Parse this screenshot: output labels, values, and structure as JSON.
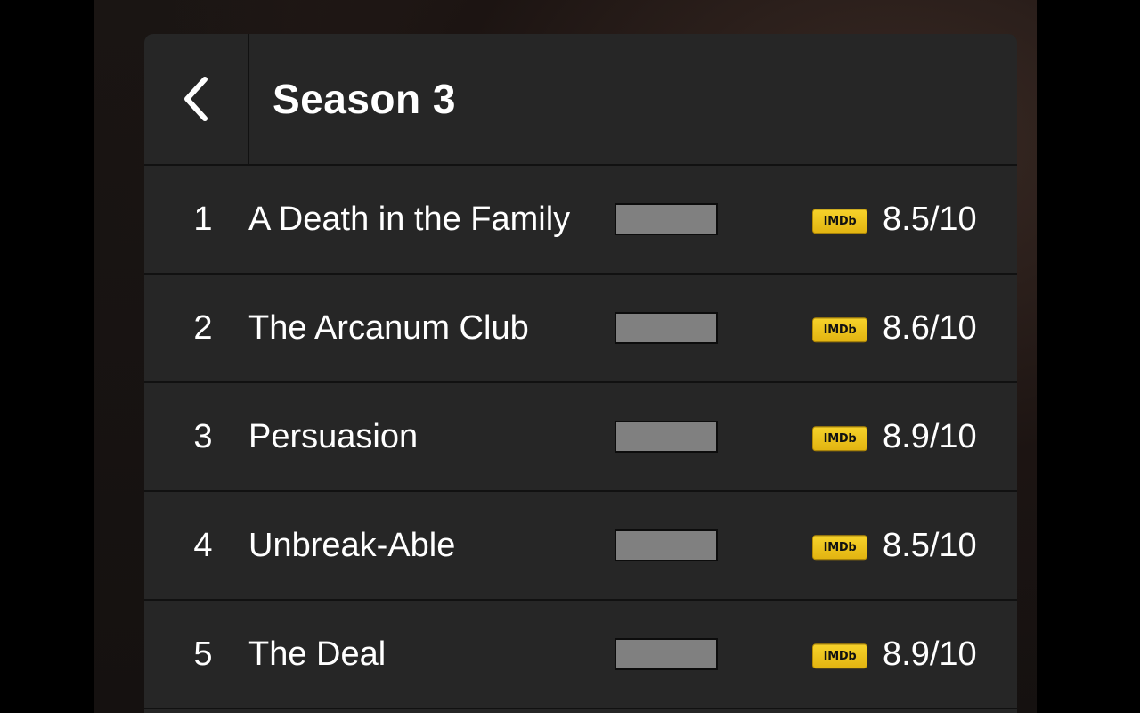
{
  "header": {
    "back_icon": "chevron-left-icon",
    "title": "Season 3"
  },
  "episodes": [
    {
      "number": "1",
      "title": "A Death in the Family",
      "badge": "IMDb",
      "rating": "8.5/10"
    },
    {
      "number": "2",
      "title": "The Arcanum Club",
      "badge": "IMDb",
      "rating": "8.6/10"
    },
    {
      "number": "3",
      "title": "Persuasion",
      "badge": "IMDb",
      "rating": "8.9/10"
    },
    {
      "number": "4",
      "title": "Unbreak-Able",
      "badge": "IMDb",
      "rating": "8.5/10"
    },
    {
      "number": "5",
      "title": "The Deal",
      "badge": "IMDb",
      "rating": "8.9/10"
    }
  ],
  "colors": {
    "panel": "#262626",
    "imdb_yellow": "#f5c518",
    "placeholder_bar": "#808080"
  }
}
